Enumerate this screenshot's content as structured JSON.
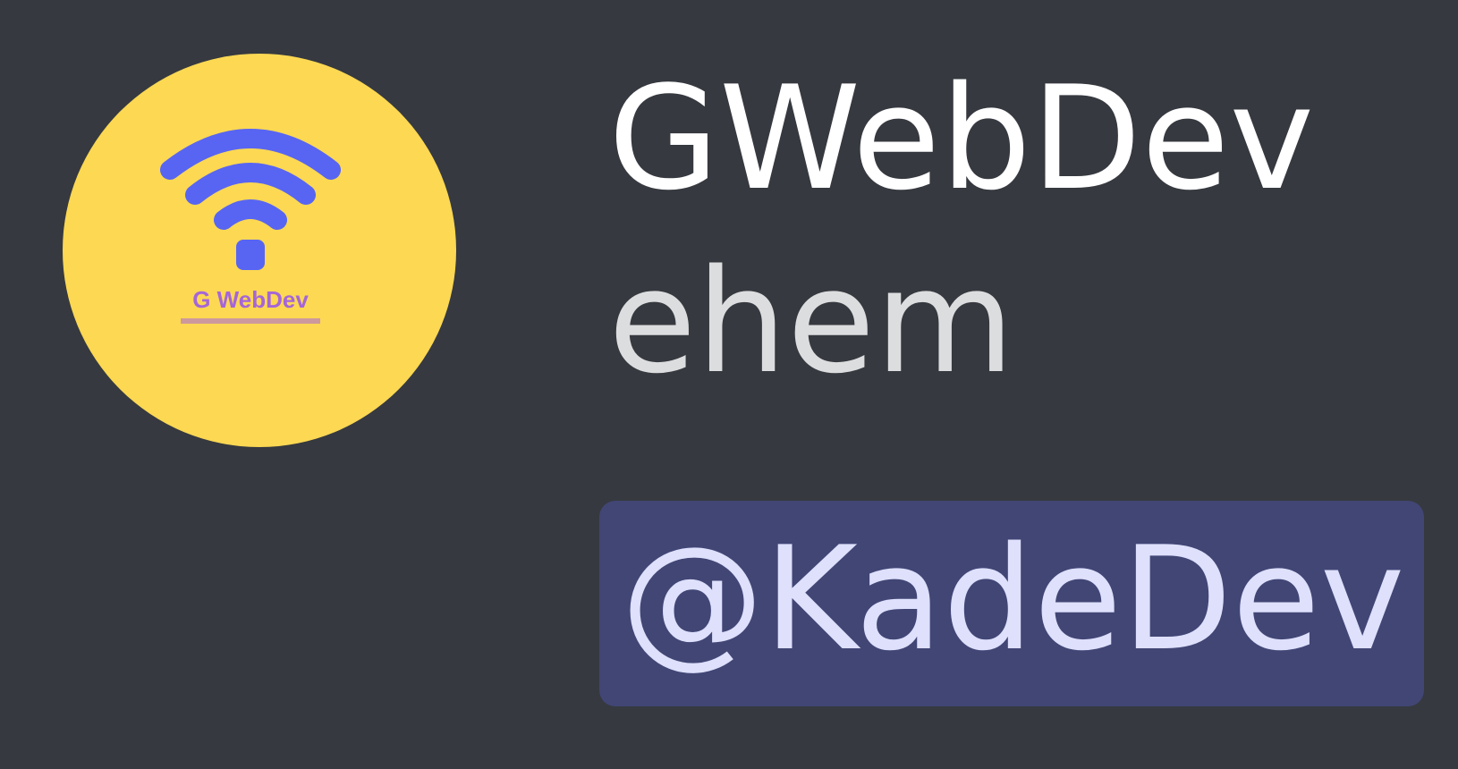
{
  "message": {
    "author": "GWebDev",
    "text": "ehem",
    "mention": "@KadeDev",
    "avatar": {
      "icon": "wifi-signal-icon",
      "logo_text": "G WebDev",
      "background": "#fcd853",
      "icon_color": "#5865f2"
    }
  },
  "colors": {
    "background": "#36393f",
    "author": "#ffffff",
    "text": "#dcddde",
    "mention_background": "#414675",
    "mention_text": "#dee0fc"
  }
}
